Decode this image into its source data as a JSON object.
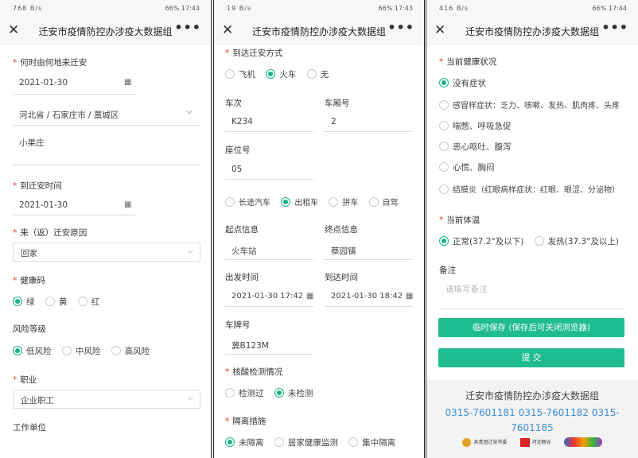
{
  "screens": [
    {
      "status": {
        "left": "768 B/s",
        "right": "66% 17:43"
      },
      "title": "迁安市疫情防控办涉疫大数据组"
    },
    {
      "status": {
        "left": "19 B/s",
        "right": "66% 17:43"
      },
      "title": "迁安市疫情防控办涉疫大数据组"
    },
    {
      "status": {
        "left": "416 B/s",
        "right": "66% 17:44"
      },
      "title": "迁安市疫情防控办涉疫大数据组"
    }
  ],
  "icons": {
    "close": "✕",
    "more": "•••",
    "calendar": "▦",
    "chevron": "⌵",
    "req": "*"
  },
  "p1": {
    "origin_label": "何时由何地来迁安",
    "origin_date": "2021-01-30",
    "region": "河北省 / 石家庄市 / 藁城区",
    "address": "小果庄",
    "arrive_label": "到迁安时间",
    "arrive_date": "2021-01-30",
    "reason_label": "来（返）迁安原因",
    "reason": "回家",
    "health_code_label": "健康码",
    "health_code_options": [
      "绿",
      "黄",
      "红"
    ],
    "risk_label": "风险等级",
    "risk_options": [
      "低风险",
      "中风险",
      "高风险"
    ],
    "job_label": "职业",
    "job": "企业职工",
    "work_label": "工作单位"
  },
  "p2": {
    "mode_label": "到达迁安方式",
    "mode_options": [
      "飞机",
      "火车",
      "无"
    ],
    "train_label": "车次",
    "train": "K234",
    "car_label": "车厢号",
    "car": "2",
    "seat_label": "座位号",
    "seat": "05",
    "transfer_options": [
      "长途汽车",
      "出租车",
      "拼车",
      "自驾"
    ],
    "start_label": "起点信息",
    "start": "火车站",
    "end_label": "终点信息",
    "end": "蔡园镇",
    "depart_label": "出发时间",
    "depart": "2021-01-30 17:42",
    "arrival_label": "到达时间",
    "arrival": "2021-01-30 18:42",
    "plate_label": "车牌号",
    "plate": "冀B123M",
    "nucleic_label": "核酸检测情况",
    "nucleic_options": [
      "检测过",
      "未检测"
    ],
    "isolation_label": "隔离措施",
    "isolation_options": [
      "未隔离",
      "居家健康监测",
      "集中隔离"
    ]
  },
  "p3": {
    "health_label": "当前健康状况",
    "health_options": [
      "没有症状",
      "感冒样症状：乏力、咳嗽、发热、肌肉疼、头疼",
      "喘憋、呼吸急促",
      "恶心呕吐、腹泻",
      "心慌、胸闷",
      "结膜炎（红眼病样症状：红眼、眼涩、分泌物）"
    ],
    "temp_label": "当前体温",
    "temp_options": [
      "正常(37.2°及以下)",
      "发热(37.3°及以上)"
    ],
    "note_label": "备注",
    "note_placeholder": "请填写备注",
    "save_button": "临时保存 (保存后可关闭浏览器)",
    "submit_button": "提 交",
    "footer_title": "迁安市疫情防控办涉疫大数据组",
    "phones": "0315-7601181  0315-7601182  0315-7601185",
    "logos": [
      "共青团迁安市委",
      "河北畅谷"
    ]
  },
  "colors": {
    "accent": "#1ebc8e",
    "required": "#ee3333",
    "link": "#3a8fd9"
  }
}
